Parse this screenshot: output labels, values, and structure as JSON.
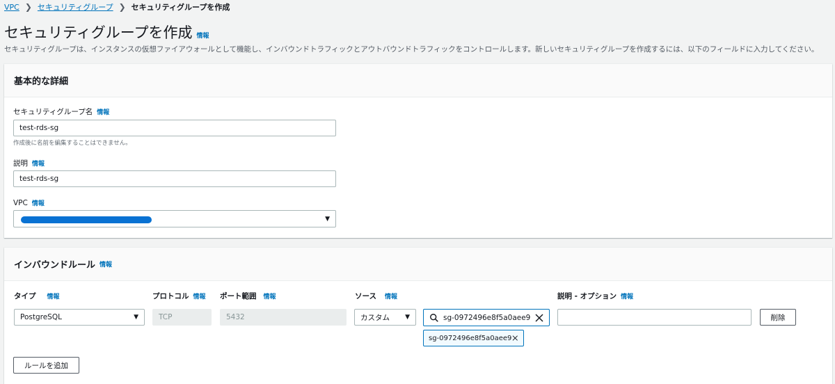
{
  "breadcrumb": {
    "vpc": "VPC",
    "security_groups": "セキュリティグループ",
    "current": "セキュリティグループを作成"
  },
  "page": {
    "title": "セキュリティグループを作成",
    "info": "情報",
    "description": "セキュリティグループは、インスタンスの仮想ファイアウォールとして機能し、インバウンドトラフィックとアウトバウンドトラフィックをコントロールします。新しいセキュリティグループを作成するには、以下のフィールドに入力してください。"
  },
  "basic": {
    "heading": "基本的な詳細",
    "name_label": "セキュリティグループ名",
    "name_info": "情報",
    "name_value": "test-rds-sg",
    "name_hint": "作成後に名前を編集することはできません。",
    "desc_label": "説明",
    "desc_info": "情報",
    "desc_value": "test-rds-sg",
    "vpc_label": "VPC",
    "vpc_info": "情報"
  },
  "inbound": {
    "heading": "インバウンドルール",
    "info": "情報",
    "columns": {
      "type": "タイプ",
      "protocol": "プロトコル",
      "port": "ポート範囲",
      "source": "ソース",
      "description": "説明 - オプション",
      "info": "情報"
    },
    "rule": {
      "type": "PostgreSQL",
      "protocol": "TCP",
      "port": "5432",
      "source_type": "カスタム",
      "source_search": "sg-0972496e8f5a0aee9",
      "source_token": "sg-0972496e8f5a0aee9",
      "description": ""
    },
    "delete_label": "削除",
    "add_rule_label": "ルールを追加"
  },
  "colors": {
    "link": "#0073bb",
    "redaction": "#0972d3"
  }
}
